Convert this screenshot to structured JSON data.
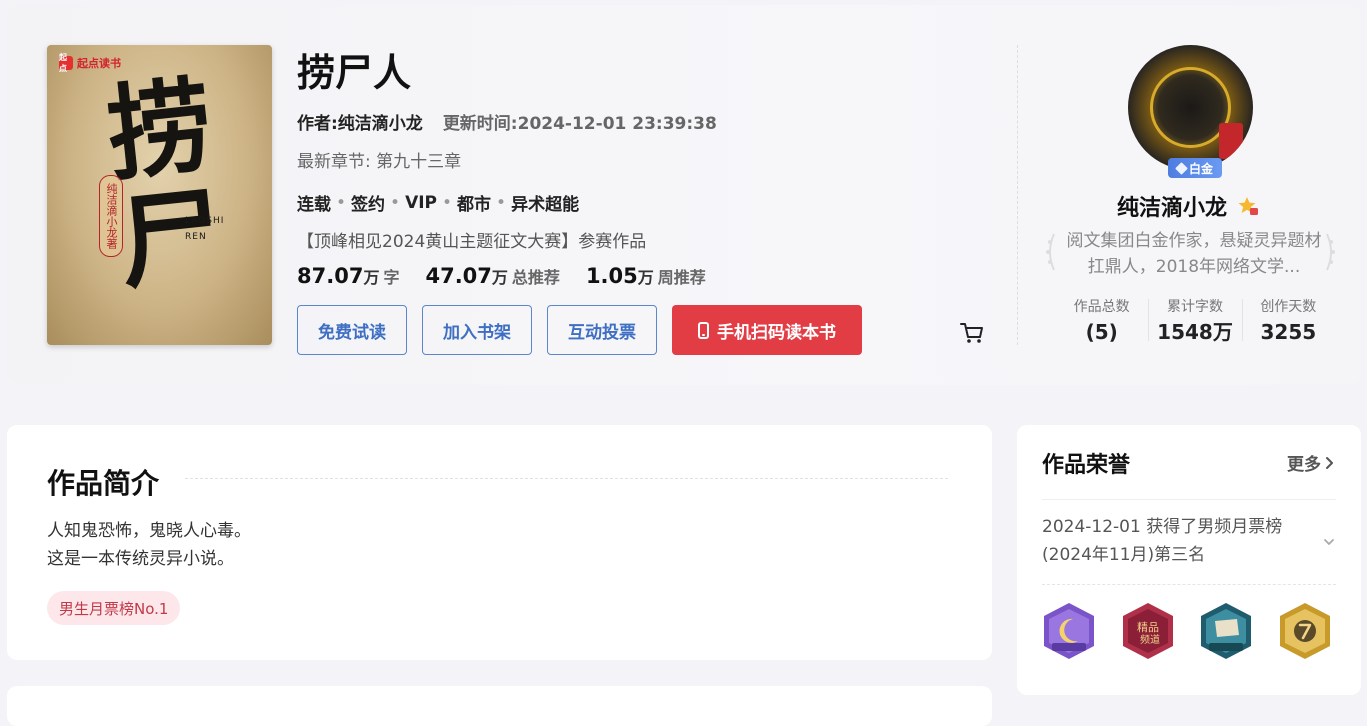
{
  "book": {
    "brand": "起点读书",
    "brand_mark": "起点",
    "cover_title": "捞尸",
    "cover_seal": "纯洁滴小龙著",
    "cover_pinyin_1": "LAOSHI",
    "cover_pinyin_2": "REN",
    "title": "捞尸人",
    "author": "作者:纯洁滴小龙",
    "update": "更新时间:2024-12-01 23:39:38",
    "latest": "最新章节: 第九十三章",
    "tags": [
      "连载",
      "签约",
      "VIP",
      "都市",
      "异术超能"
    ],
    "contest": "【顶峰相见2024黄山主题征文大赛】参赛作品",
    "stats": [
      {
        "num": "87.07",
        "unit": "万",
        "label": "字"
      },
      {
        "num": "47.07",
        "unit": "万",
        "label": "总推荐"
      },
      {
        "num": "1.05",
        "unit": "万",
        "label": "周推荐"
      }
    ],
    "buttons": {
      "free_read": "免费试读",
      "add_shelf": "加入书架",
      "vote": "互动投票",
      "scan": "手机扫码读本书"
    }
  },
  "author_panel": {
    "badge": "白金",
    "name": "纯洁滴小龙",
    "desc": "阅文集团白金作家，悬疑灵异题材扛鼎人，2018年网络文学...",
    "stats": [
      {
        "label": "作品总数",
        "value": "5"
      },
      {
        "label": "累计字数",
        "value": "1548万"
      },
      {
        "label": "创作天数",
        "value": "3255"
      }
    ]
  },
  "intro": {
    "title": "作品简介",
    "line1": "人知鬼恐怖，鬼晓人心毒。",
    "line2": "这是一本传统灵异小说。",
    "tag": "男生月票榜No.1"
  },
  "honor": {
    "title": "作品荣誉",
    "more": "更多",
    "item": "2024-12-01 获得了男频月票榜(2024年11月)第三名",
    "medals": [
      "moon-medal",
      "quality-medal",
      "flag-medal",
      "gold-seven-medal"
    ]
  },
  "colors": {
    "accent_blue": "#3e6fc2",
    "accent_red": "#e23c45",
    "tag_pink": "#fde7ea"
  }
}
